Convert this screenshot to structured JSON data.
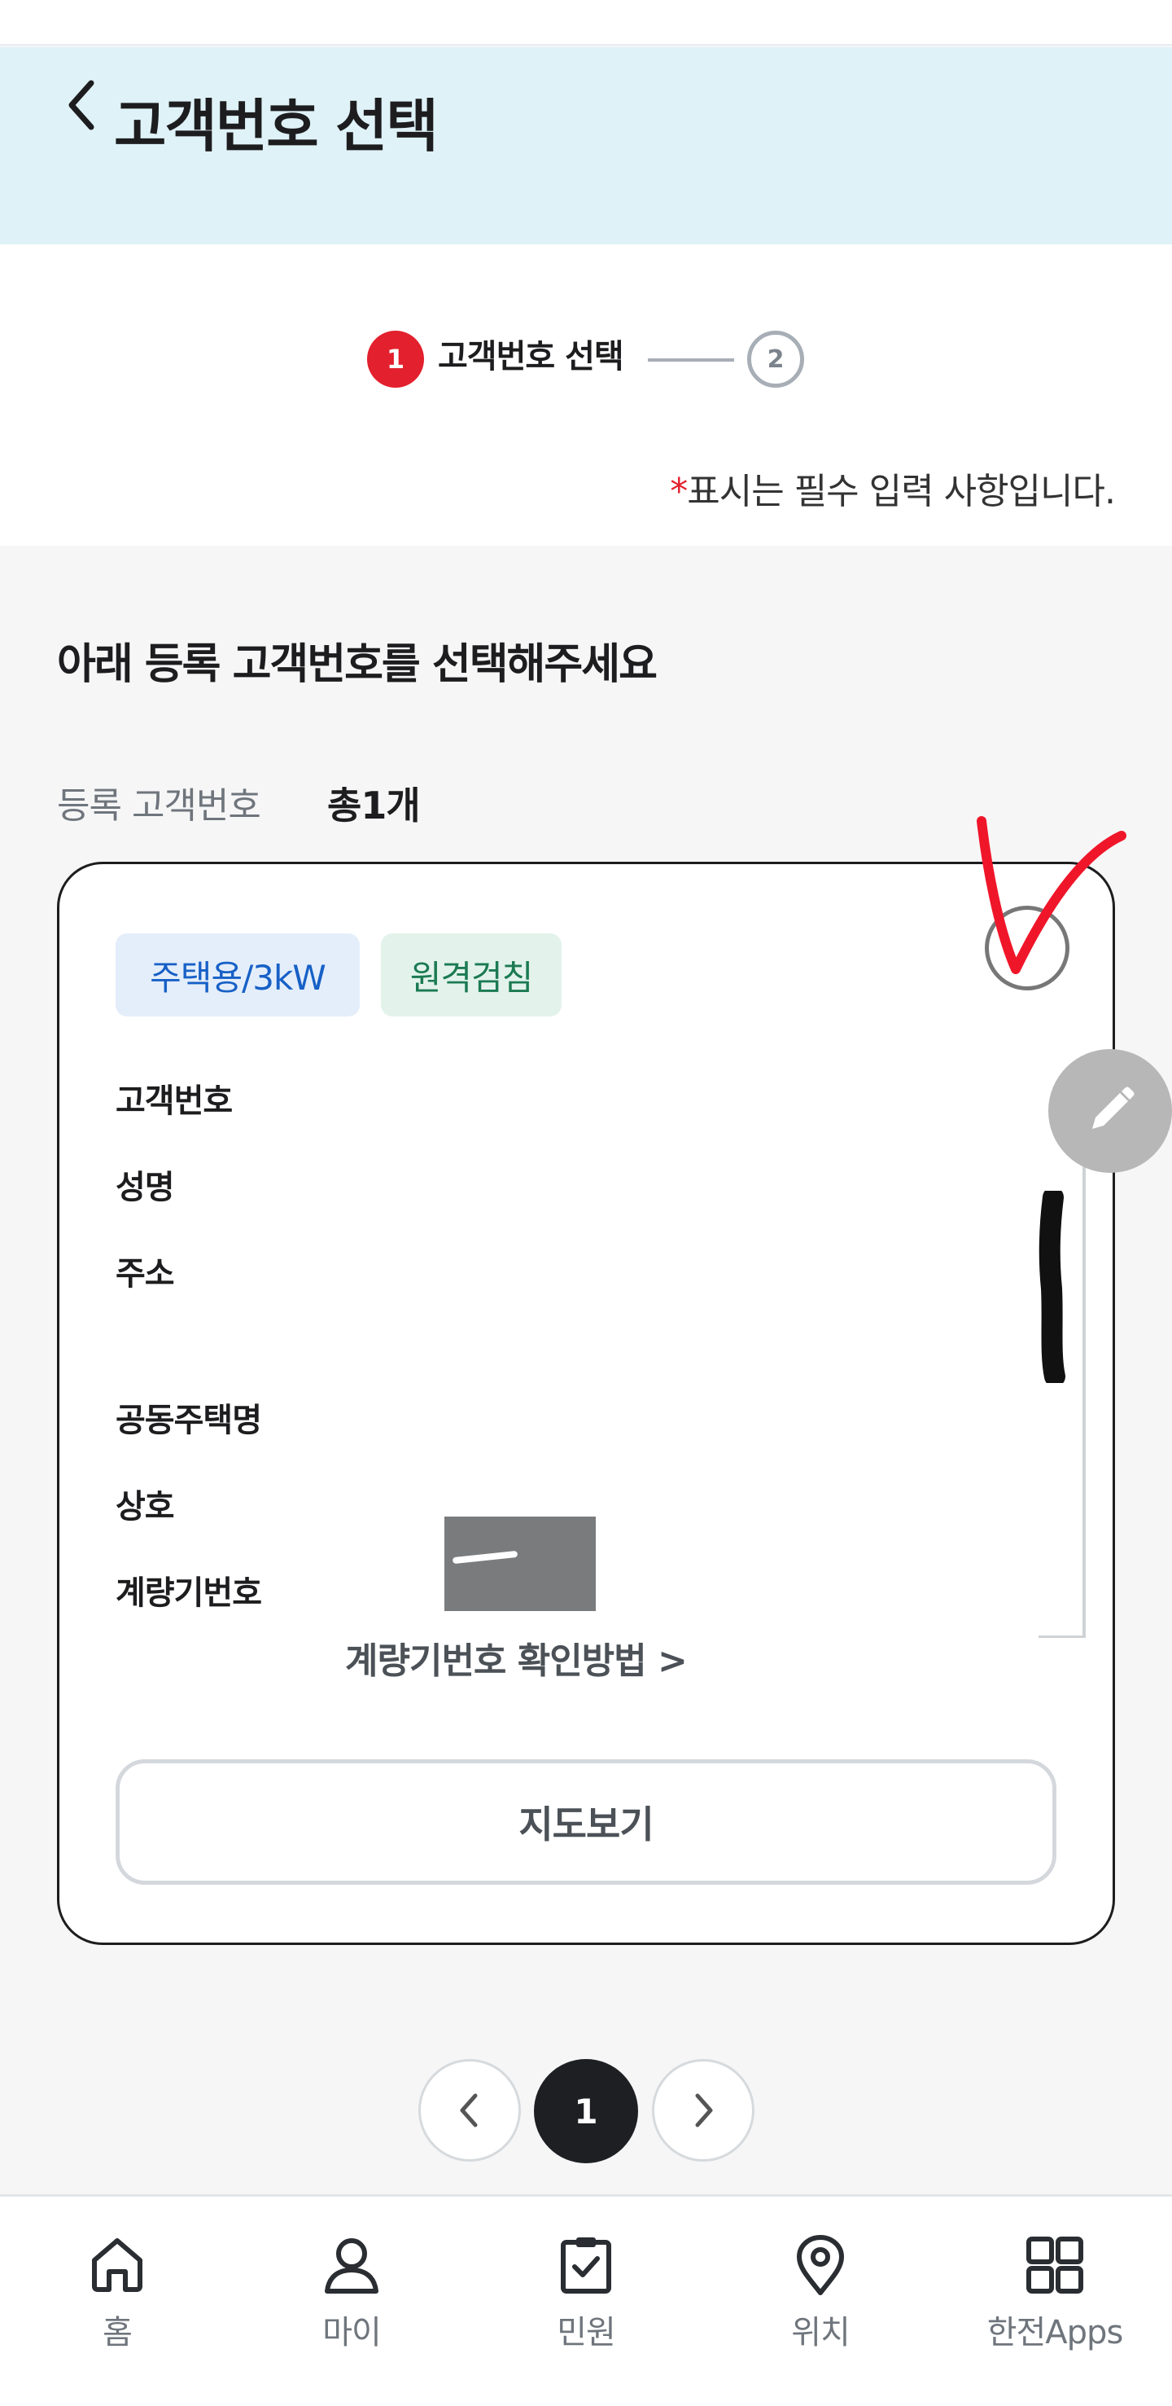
{
  "header": {
    "title": "고객번호 선택"
  },
  "steps": {
    "step1_number": "1",
    "step1_label": "고객번호 선택",
    "step2_number": "2"
  },
  "required_note": {
    "star": "*",
    "text": "표시는 필수 입력 사항입니다."
  },
  "section": {
    "title": "아래 등록 고객번호를 선택해주세요",
    "count_label": "등록 고객번호",
    "count_value": "총1개"
  },
  "card": {
    "badge_type": "주택용/3kW",
    "badge_remote": "원격검침",
    "labels": {
      "customer_number": "고객번호",
      "name": "성명",
      "address": "주소",
      "apartment_name": "공동주택명",
      "business_name": "상호",
      "meter_number": "계량기번호"
    },
    "meter_link": "계량기번호 확인방법 >",
    "map_button": "지도보기"
  },
  "pagination": {
    "current": "1"
  },
  "bottom_nav": [
    {
      "label": "홈",
      "icon": "home-icon"
    },
    {
      "label": "마이",
      "icon": "user-icon"
    },
    {
      "label": "민원",
      "icon": "clipboard-check-icon"
    },
    {
      "label": "위치",
      "icon": "location-pin-icon"
    },
    {
      "label": "한전Apps",
      "icon": "apps-grid-icon"
    }
  ],
  "colors": {
    "header_bg": "#dff2f7",
    "step_active": "#e3202d",
    "badge_type_text": "#1760c6",
    "badge_remote_text": "#1b7a52",
    "annotation_red": "#f0162a"
  }
}
